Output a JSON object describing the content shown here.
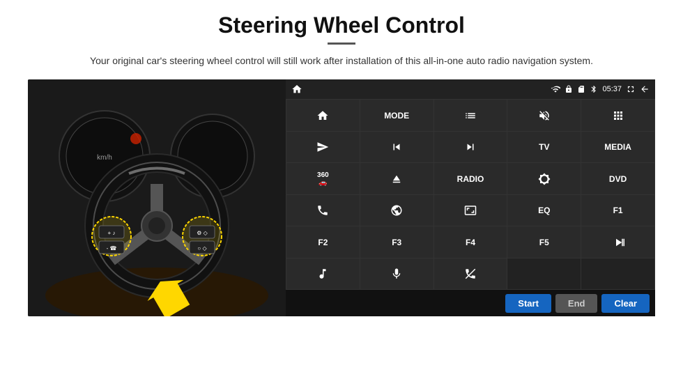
{
  "page": {
    "title": "Steering Wheel Control",
    "subtitle": "Your original car's steering wheel control will still work after installation of this all-in-one auto radio navigation system."
  },
  "status_bar": {
    "time": "05:37",
    "icons": [
      "wifi",
      "lock",
      "sd",
      "bluetooth",
      "battery",
      "fullscreen",
      "back"
    ]
  },
  "grid_buttons": [
    {
      "id": "home",
      "type": "icon",
      "icon": "home"
    },
    {
      "id": "mode",
      "type": "text",
      "label": "MODE"
    },
    {
      "id": "list",
      "type": "icon",
      "icon": "list"
    },
    {
      "id": "mute",
      "type": "icon",
      "icon": "mute"
    },
    {
      "id": "apps",
      "type": "icon",
      "icon": "apps"
    },
    {
      "id": "send",
      "type": "icon",
      "icon": "send"
    },
    {
      "id": "prev",
      "type": "icon",
      "icon": "prev"
    },
    {
      "id": "next",
      "type": "icon",
      "icon": "next"
    },
    {
      "id": "tv",
      "type": "text",
      "label": "TV"
    },
    {
      "id": "media",
      "type": "text",
      "label": "MEDIA"
    },
    {
      "id": "360cam",
      "type": "icon",
      "icon": "360cam"
    },
    {
      "id": "eject",
      "type": "icon",
      "icon": "eject"
    },
    {
      "id": "radio",
      "type": "text",
      "label": "RADIO"
    },
    {
      "id": "brightness",
      "type": "icon",
      "icon": "brightness"
    },
    {
      "id": "dvd",
      "type": "text",
      "label": "DVD"
    },
    {
      "id": "phone",
      "type": "icon",
      "icon": "phone"
    },
    {
      "id": "swirl",
      "type": "icon",
      "icon": "swirl"
    },
    {
      "id": "aspect",
      "type": "icon",
      "icon": "aspect"
    },
    {
      "id": "eq",
      "type": "text",
      "label": "EQ"
    },
    {
      "id": "f1",
      "type": "text",
      "label": "F1"
    },
    {
      "id": "f2",
      "type": "text",
      "label": "F2"
    },
    {
      "id": "f3",
      "type": "text",
      "label": "F3"
    },
    {
      "id": "f4",
      "type": "text",
      "label": "F4"
    },
    {
      "id": "f5",
      "type": "text",
      "label": "F5"
    },
    {
      "id": "playpause",
      "type": "icon",
      "icon": "playpause"
    },
    {
      "id": "music",
      "type": "icon",
      "icon": "music"
    },
    {
      "id": "mic",
      "type": "icon",
      "icon": "mic"
    },
    {
      "id": "callend",
      "type": "icon",
      "icon": "callend"
    },
    {
      "id": "empty1",
      "type": "empty"
    },
    {
      "id": "empty2",
      "type": "empty"
    }
  ],
  "action_bar": {
    "start_label": "Start",
    "end_label": "End",
    "clear_label": "Clear"
  }
}
